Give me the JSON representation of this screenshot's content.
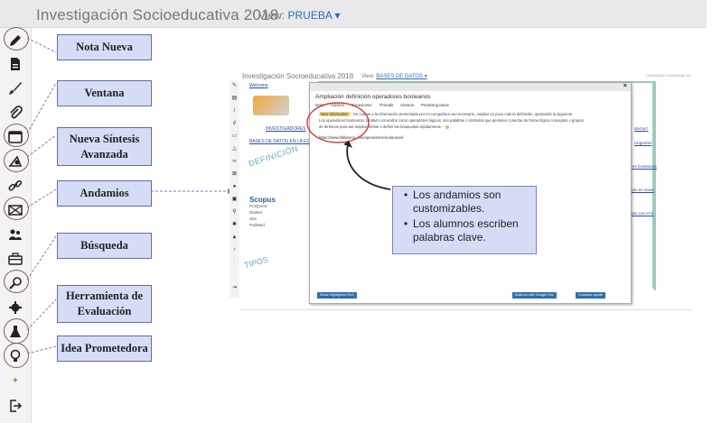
{
  "header": {
    "title": "Investigación Socioeducativa 2018",
    "view_label": "View:",
    "view_value": "PRUEBA ▾"
  },
  "sidebar": {
    "icons": [
      "pencil-icon",
      "document-icon",
      "brush-icon",
      "paperclip-icon",
      "window-icon",
      "synthesis-icon",
      "link-icon",
      "scaffold-icon",
      "group-icon",
      "briefcase-icon",
      "search-icon",
      "gear-icon",
      "flask-icon",
      "lightbulb-icon",
      "small-icon",
      "exit-icon"
    ]
  },
  "labels": {
    "nota_nueva": "Nota Nueva",
    "ventana": "Ventana",
    "nueva_sintesis": "Nueva Síntesis\nAvanzada",
    "andamios": "Andamios",
    "busqueda": "Búsqueda",
    "herramienta": "Herramienta de\nEvaluación",
    "idea": "Idea Prometedora"
  },
  "screenshot": {
    "title": "Investigación Socioeducativa 2018",
    "view_label": "View:",
    "view_value": "BASES DE DATOS ▾",
    "right_text": "COMUNIDAD COMUNIDAD iorl",
    "welcome": "Welcome",
    "investigadores": "INVESTIGADORES",
    "bases": "BASES DE DATOS EN LA EDUC",
    "definicion": "DEFINICIÓN",
    "tipos": "TIPOS",
    "right_links": [
      "idezas?",
      "Ungentes",
      "ores booleanos",
      "ado en clase",
      "ado con el lo"
    ],
    "logos": {
      "scopus": "Scopus",
      "l1": "ProQuest",
      "l2": "Dialnet",
      "l3": "vlex",
      "l4": "PubMed"
    },
    "modal": {
      "close": "×",
      "title": "Ampliación definición operadores booleanos",
      "tabs": [
        "Nota",
        "Autores",
        "Conexiones",
        "Threads",
        "Historia",
        "Promising Ideas"
      ],
      "tag": "New Information",
      "line1": "- En cuanto a la información presentada por mi compañera veo necesario, ampliar un poco más la definición, aportando la siguiente.",
      "line2": "Los operadores booleanos, también conocidos como operadores lógicos, son palabras o símbolos que permiten conectar de forma lógica conceptos o grupos",
      "line3": "de términos para así ampliar, limitar o definir las búsquedas rápidamente. -",
      "url": "https://www.biblioteca.com/operadores-booleanos/",
      "btn_highlight": "Show Highlighted Text",
      "btn_google": "Build-on with Google Doc",
      "btn_build": "Construir aporte"
    }
  },
  "callout": {
    "items": [
      "Los andamios son customizables.",
      "Los alumnos escriben palabras clave."
    ]
  }
}
